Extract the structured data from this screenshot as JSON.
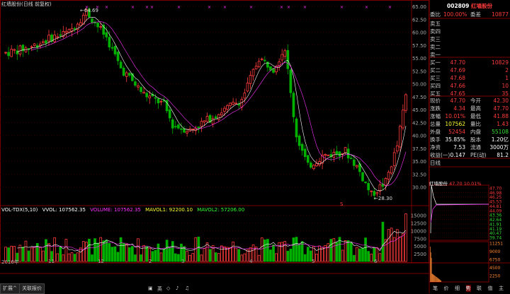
{
  "chart_title": "红墙股份(日线 前复权)",
  "main_axis": [
    "65.00",
    "62.50",
    "60.00",
    "57.50",
    "55.00",
    "52.50",
    "50.00",
    "47.50",
    "45.00",
    "42.50",
    "40.00",
    "37.50",
    "35.00",
    "32.50",
    "30.00"
  ],
  "vol_axis": [
    "15000",
    "12500",
    "10000",
    "7500",
    "5000",
    "2500"
  ],
  "max_label": "64.69",
  "min_label": "28.30",
  "event_label": "S",
  "vol_legend": {
    "name": "VOL-TDX(5,10)",
    "vvol": "VVOL: 107562.35",
    "volume": "VOLUME: 107562.35",
    "mavol1": "MAVOL1: 92200.10",
    "mavol2": "MAVOL2: 57206.00"
  },
  "month_labels": [
    "2016年",
    "11",
    "12",
    "2",
    "3",
    "4",
    "5",
    "6"
  ],
  "bottom_tabs": [
    "扩展^",
    "关联报价"
  ],
  "toolbar_icons": [
    "▣",
    "英",
    "◇",
    "♪",
    "♫"
  ],
  "quote": {
    "code": "002809",
    "name": "红墙股份",
    "webi_label": "委比",
    "webi": "100.00%",
    "weicha_label": "委差",
    "weicha": "10877",
    "sell": [
      {
        "label": "卖五",
        "price": "",
        "vol": ""
      },
      {
        "label": "卖四",
        "price": "",
        "vol": ""
      },
      {
        "label": "卖三",
        "price": "",
        "vol": ""
      },
      {
        "label": "卖二",
        "price": "",
        "vol": ""
      },
      {
        "label": "卖一",
        "price": "",
        "vol": ""
      }
    ],
    "buy": [
      {
        "label": "买一",
        "price": "47.70",
        "vol": "10829"
      },
      {
        "label": "买二",
        "price": "47.69",
        "vol": "2"
      },
      {
        "label": "买三",
        "price": "47.68",
        "vol": "1"
      },
      {
        "label": "买四",
        "price": "47.66",
        "vol": "10"
      },
      {
        "label": "买五",
        "price": "47.65",
        "vol": "35"
      }
    ],
    "stats": [
      {
        "l1": "现价",
        "v1": "47.70",
        "c1": "red",
        "l2": "今开",
        "v2": "42.30",
        "c2": "red"
      },
      {
        "l1": "涨跌",
        "v1": "4.34",
        "c1": "red",
        "l2": "最高",
        "v2": "47.70",
        "c2": "red"
      },
      {
        "l1": "涨幅",
        "v1": "10.01%",
        "c1": "red",
        "l2": "最低",
        "v2": "41.88",
        "c2": "red"
      },
      {
        "l1": "总量",
        "v1": "107562",
        "c1": "yel",
        "l2": "量比",
        "v2": "1.43",
        "c2": "red"
      },
      {
        "l1": "外盘",
        "v1": "52454",
        "c1": "red",
        "l2": "内盘",
        "v2": "55108",
        "c2": "green"
      },
      {
        "l1": "换手",
        "v1": "35.85%",
        "c1": "white",
        "l2": "股本",
        "v2": "1.20亿",
        "c2": "white"
      },
      {
        "l1": "净资",
        "v1": "7.53",
        "c1": "white",
        "l2": "流通",
        "v2": "3000万",
        "c2": "white"
      },
      {
        "l1": "收益(一)",
        "v1": "0.147",
        "c1": "white",
        "l2": "PE(动)",
        "v2": "81.2",
        "c2": "white"
      }
    ],
    "riline": "日线"
  },
  "mini": {
    "title": "红墙股份",
    "price": "47.70",
    "pct": "10.01%",
    "left_axis": [
      "47.70",
      "46.98",
      "46.25",
      "45.53",
      "44.81",
      "44.09",
      "43.36",
      "42.64",
      "41.91",
      "41.19",
      "40.47",
      "39.74"
    ],
    "vol_axis": [
      "11251",
      "9000",
      "6750",
      "4500",
      "2250"
    ],
    "tabs": [
      "笔",
      "价",
      "细",
      "势",
      "联",
      "值",
      "主"
    ]
  },
  "colors": {
    "up": "#ff3b3b",
    "down": "#00b000",
    "ma5": "#ffffff",
    "ma10": "#ff33ff",
    "grid": "#7a0000"
  }
}
